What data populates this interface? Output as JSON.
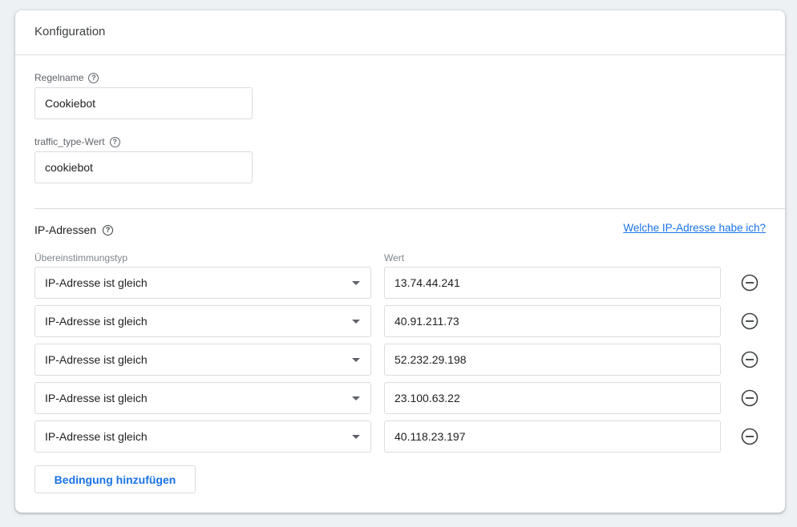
{
  "card": {
    "title": "Konfiguration"
  },
  "rule_name": {
    "label": "Regelname",
    "value": "Cookiebot"
  },
  "traffic_type": {
    "label": "traffic_type-Wert",
    "value": "cookiebot"
  },
  "ip_section": {
    "title": "IP-Adressen",
    "link_text": "Welche IP-Adresse habe ich?",
    "match_type_label": "Übereinstimmungstyp",
    "value_label": "Wert",
    "rows": [
      {
        "match_type": "IP-Adresse ist gleich",
        "value": "13.74.44.241"
      },
      {
        "match_type": "IP-Adresse ist gleich",
        "value": "40.91.211.73"
      },
      {
        "match_type": "IP-Adresse ist gleich",
        "value": "52.232.29.198"
      },
      {
        "match_type": "IP-Adresse ist gleich",
        "value": "23.100.63.22"
      },
      {
        "match_type": "IP-Adresse ist gleich",
        "value": "40.118.23.197"
      }
    ],
    "add_button_label": "Bedingung hinzufügen"
  },
  "icons": {
    "help": "help-circle-icon",
    "dropdown": "caret-down-icon",
    "remove": "remove-circle-icon"
  },
  "colors": {
    "accent": "#1a73e8",
    "border": "#dadce0",
    "background": "#eef1f4"
  }
}
